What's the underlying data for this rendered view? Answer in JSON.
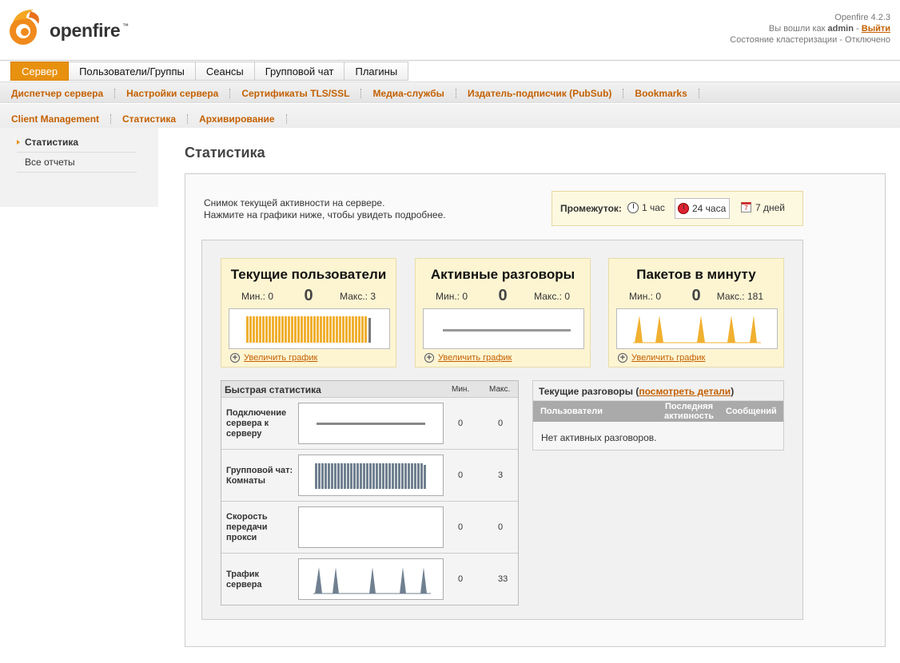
{
  "brand": {
    "name": "openfire",
    "tm": "™"
  },
  "header": {
    "version": "Openfire 4.2.3",
    "logged_in_prefix": "Вы вошли как",
    "user": "admin",
    "separator": "-",
    "logout": "Выйти",
    "cluster": "Состояние кластеризации - Отключено"
  },
  "tabs": [
    {
      "label": "Сервер",
      "active": true
    },
    {
      "label": "Пользователи/Группы"
    },
    {
      "label": "Сеансы"
    },
    {
      "label": "Групповой чат"
    },
    {
      "label": "Плагины"
    }
  ],
  "subnav1": [
    "Диспетчер сервера",
    "Настройки сервера",
    "Сертификаты TLS/SSL",
    "Медиа-службы",
    "Издатель-подписчик (PubSub)",
    "Bookmarks"
  ],
  "subnav2": [
    "Client Management",
    "Статистика",
    "Архивирование"
  ],
  "sidebar": [
    "Статистика",
    "Все отчеты"
  ],
  "page": {
    "title": "Статистика",
    "intro_line1": "Снимок текущей активности на сервере.",
    "intro_line2": "Нажмите на графики ниже, чтобы увидеть подробнее."
  },
  "period": {
    "label": "Промежуток:",
    "options": [
      "1 час",
      "24 часа",
      "7 дней"
    ],
    "selected": "24 часа",
    "calendar_day": "7"
  },
  "cards": [
    {
      "title": "Текущие пользователи",
      "min": "Мин.: 0",
      "current": "0",
      "max": "Макс.: 3",
      "zoom": "Увеличить график"
    },
    {
      "title": "Активные разговоры",
      "min": "Мин.: 0",
      "current": "0",
      "max": "Макс.: 0",
      "zoom": "Увеличить график"
    },
    {
      "title": "Пакетов в минуту",
      "min": "Мин.: 0",
      "current": "0",
      "max": "Макс.: 181",
      "zoom": "Увеличить график"
    }
  ],
  "quick_stats": {
    "title": "Быстрая статистика",
    "col_min": "Мин.",
    "col_max": "Макс.",
    "rows": [
      {
        "label": "Подключение сервера к серверу",
        "min": "0",
        "max": "0"
      },
      {
        "label": "Групповой чат: Комнаты",
        "min": "0",
        "max": "3"
      },
      {
        "label": "Скорость передачи прокси",
        "min": "0",
        "max": "0"
      },
      {
        "label": "Трафик сервера",
        "min": "0",
        "max": "33"
      }
    ]
  },
  "conversations": {
    "title_prefix": "Текущие разговоры (",
    "details_link": "посмотреть детали",
    "title_suffix": ")",
    "columns": [
      "Пользователи",
      "Последняя активность",
      "Сообщений"
    ],
    "empty": "Нет активных разговоров."
  },
  "colors": {
    "accent": "#e8910f",
    "link": "#c46000",
    "card_bg": "#fdf5d2",
    "graph_bar": "#f0b030",
    "graph_gray": "#708090"
  }
}
